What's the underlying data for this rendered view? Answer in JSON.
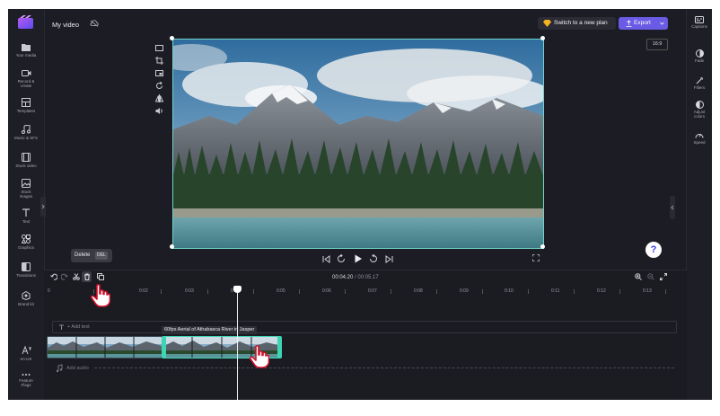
{
  "app": {
    "project_title": "My video",
    "plan_button": "Switch to a new plan",
    "export_button": "Export",
    "aspect_ratio": "16:9"
  },
  "left_sidebar": [
    {
      "label": "Your media",
      "icon": "folder-icon"
    },
    {
      "label": "Record & create",
      "icon": "camera-icon"
    },
    {
      "label": "Templates",
      "icon": "templates-icon"
    },
    {
      "label": "Music & SFX",
      "icon": "music-icon"
    },
    {
      "label": "Stock video",
      "icon": "film-icon"
    },
    {
      "label": "Stock images",
      "icon": "image-icon"
    },
    {
      "label": "Text",
      "icon": "text-icon"
    },
    {
      "label": "Graphics",
      "icon": "shapes-icon"
    },
    {
      "label": "Transitions",
      "icon": "transitions-icon"
    },
    {
      "label": "Brand kit",
      "icon": "brand-kit-icon"
    },
    {
      "label": "en-US",
      "icon": "language-icon"
    },
    {
      "label": "Feature Flags",
      "icon": "more-icon"
    }
  ],
  "right_sidebar": [
    {
      "label": "Captions",
      "icon": "captions-icon"
    },
    {
      "label": "Fade",
      "icon": "fade-icon"
    },
    {
      "label": "Filters",
      "icon": "filters-icon"
    },
    {
      "label": "Adjust colors",
      "icon": "adjust-colors-icon"
    },
    {
      "label": "Speed",
      "icon": "speed-icon"
    }
  ],
  "tooltip": {
    "label": "Delete",
    "shortcut": "DEL"
  },
  "timeline": {
    "current_time": "00:04.20",
    "total_time": "/ 00:05.17",
    "ticks": [
      "0",
      "0:02",
      "0:03",
      "0:04",
      "0:05",
      "0:06",
      "0:07",
      "0:08",
      "0:09",
      "0:10",
      "0:11",
      "0:12",
      "0:13"
    ],
    "text_lane": "+ Add text",
    "audio_lane": "Add audio",
    "clip_label": "60fps Aerial of Athabasca River in Jasper"
  },
  "colors": {
    "accent": "#6a5be4",
    "selection": "#3fd4b3",
    "background": "#1c1c24"
  }
}
